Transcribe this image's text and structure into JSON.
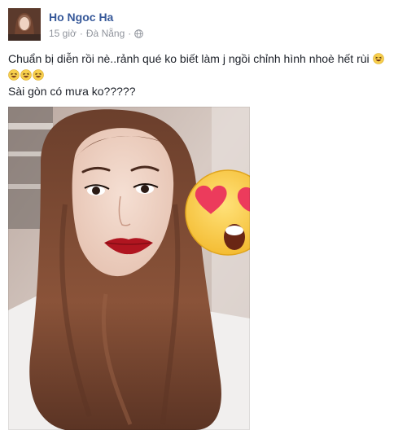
{
  "post": {
    "author": "Ho Ngoc Ha",
    "time": "15 giờ",
    "separator": "·",
    "location": "Đà Nẵng",
    "privacy_icon": "globe-icon",
    "text_line_1": "Chuẩn bị diễn rồi nè..rảnh qué ko biết làm j ngồi chỉnh hình nhoè hết rùi",
    "text_line_3": "Sài gòn có mưa ko?????",
    "emoji": "grinning-squint-emoji",
    "photo_sticker": "heart-eyes-emoji-sticker"
  },
  "colors": {
    "name_link": "#365899",
    "meta_gray": "#90949c",
    "text": "#1d2129"
  }
}
